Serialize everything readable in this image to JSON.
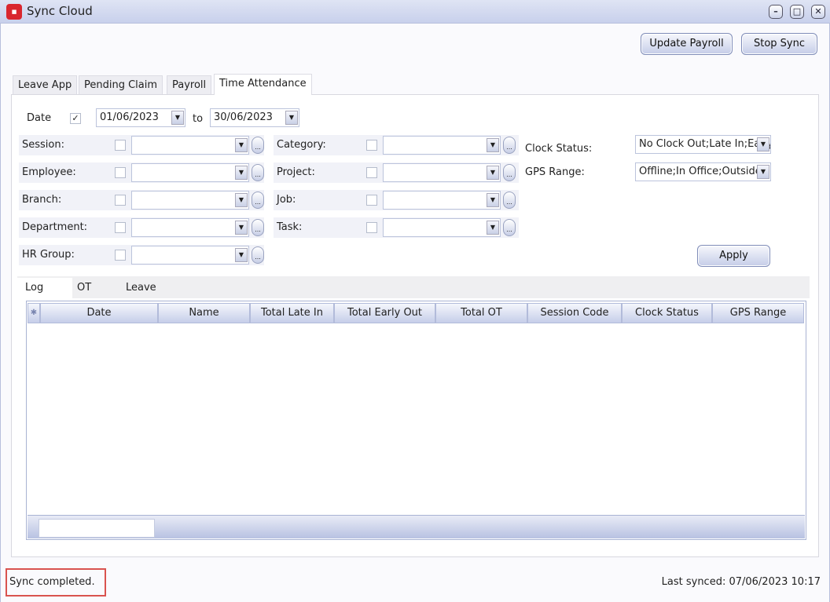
{
  "window": {
    "title": "Sync Cloud",
    "icon": "app-logo-icon",
    "controls": [
      "minimize-icon",
      "maximize-icon",
      "close-icon"
    ]
  },
  "toolbar": {
    "update_payroll": "Update Payroll",
    "stop_sync": "Stop Sync"
  },
  "tabs": [
    {
      "label": "Leave App"
    },
    {
      "label": "Pending Claim"
    },
    {
      "label": "Payroll"
    },
    {
      "label": "Time Attendance",
      "selected": true
    }
  ],
  "filters": {
    "date_label": "Date",
    "date_checked": true,
    "date_from": "01/06/2023",
    "to_label": "to",
    "date_to": "30/06/2023",
    "left": [
      {
        "label": "Session:"
      },
      {
        "label": "Employee:"
      },
      {
        "label": "Branch:"
      },
      {
        "label": "Department:"
      },
      {
        "label": "HR Group:"
      }
    ],
    "middle": [
      {
        "label": "Category:"
      },
      {
        "label": "Project:"
      },
      {
        "label": "Job:"
      },
      {
        "label": "Task:"
      }
    ],
    "clock_status_label": "Clock Status:",
    "clock_status_value": "No Clock Out;Late In;Early Out",
    "gps_range_label": "GPS Range:",
    "gps_range_value": "Offline;In Office;Outside",
    "apply": "Apply"
  },
  "inner_tabs": [
    {
      "label": "Log",
      "selected": true
    },
    {
      "label": "OT"
    },
    {
      "label": "Leave"
    }
  ],
  "grid": {
    "columns": [
      "Date",
      "Name",
      "Total Late In",
      "Total Early Out",
      "Total OT",
      "Session Code",
      "Clock Status",
      "GPS Range"
    ],
    "rows": []
  },
  "status": {
    "message": "Sync completed.",
    "last_synced": "Last synced: 07/06/2023 10:17"
  }
}
